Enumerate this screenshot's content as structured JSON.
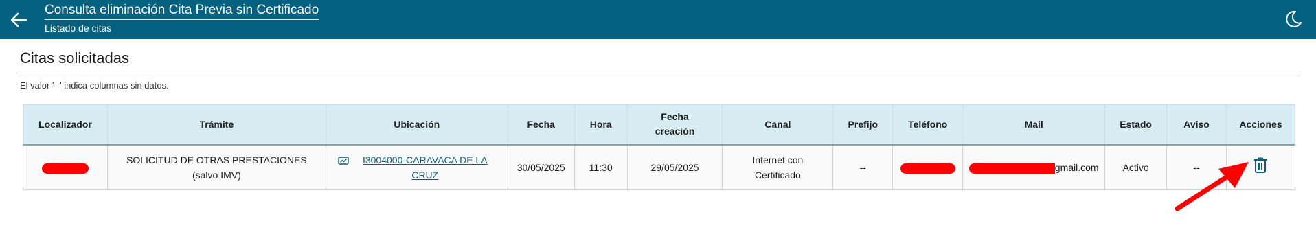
{
  "header": {
    "title": "Consulta eliminación Cita Previa sin Certificado",
    "subtitle": "Listado de citas"
  },
  "section": {
    "title": "Citas solicitadas",
    "note": "El valor '--' indica columnas sin datos."
  },
  "table": {
    "columns": [
      "Localizador",
      "Trámite",
      "Ubicación",
      "Fecha",
      "Hora",
      "Fecha creación",
      "Canal",
      "Prefijo",
      "Teléfono",
      "Mail",
      "Estado",
      "Aviso",
      "Acciones"
    ],
    "rows": [
      {
        "localizador": "",
        "tramite": "SOLICITUD DE OTRAS PRESTACIONES (salvo IMV)",
        "ubicacion": "I3004000-CARAVACA DE LA CRUZ",
        "fecha": "30/05/2025",
        "hora": "11:30",
        "fecha_creacion": "29/05/2025",
        "canal": "Internet con Certificado",
        "prefijo": "--",
        "telefono": "",
        "mail": "gmail.com",
        "estado": "Activo",
        "aviso": "--"
      }
    ]
  },
  "icons": {
    "back": "arrow-left-icon",
    "theme": "moon-icon",
    "location": "map-icon",
    "delete": "trash-icon"
  },
  "colors": {
    "topbar": "#04617f",
    "table_header": "#d8ecf4",
    "link": "#0b5f7a",
    "annotation": "#ff0000"
  }
}
